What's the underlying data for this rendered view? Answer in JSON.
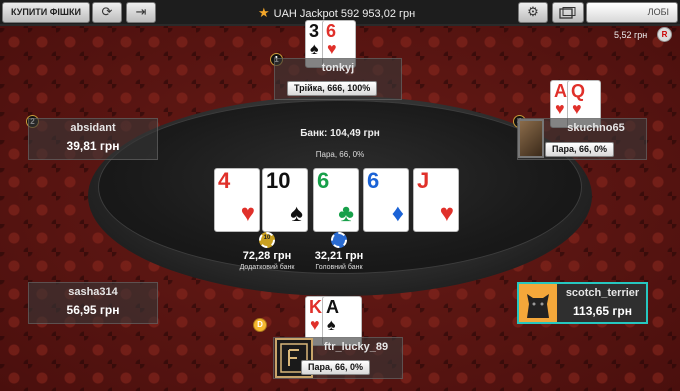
{
  "topbar": {
    "buy_chips_label": "КУПИТИ ФІШКИ",
    "refresh_icon": "refresh-icon",
    "exit_icon": "exit-icon",
    "jackpot_text": "UAH Jackpot  592 953,02 грн",
    "settings_icon": "gear-icon",
    "tables_icon": "tables-icon",
    "lobby_label": "ЛОБІ",
    "timer": "5,52 грн",
    "r_badge": "R"
  },
  "table": {
    "pot_label": "Банк: 104,49 грн",
    "hand_desc": "Пара, 66, 0%",
    "board": [
      {
        "rank": "4",
        "suit": "♥",
        "color": "red"
      },
      {
        "rank": "10",
        "suit": "♠",
        "color": "black"
      },
      {
        "rank": "6",
        "suit": "♣",
        "color": "green"
      },
      {
        "rank": "6",
        "suit": "♦",
        "color": "blue"
      },
      {
        "rank": "J",
        "suit": "♥",
        "color": "red"
      }
    ],
    "side_pot": {
      "amount": "72,28 грн",
      "label": "Додатковий банк",
      "chip_count": "10"
    },
    "main_pot": {
      "amount": "32,21 грн",
      "label": "Головний банк"
    },
    "dealer_label": "D"
  },
  "seats": {
    "tonkyj": {
      "name": "tonkyj",
      "number": "1",
      "hand": "Трійка, 666, 100%",
      "cards": [
        {
          "rank": "3",
          "suit": "♠",
          "color": "black"
        },
        {
          "rank": "6",
          "suit": "♥",
          "color": "red"
        }
      ]
    },
    "absidant": {
      "name": "absidant",
      "number": "2",
      "stack": "39,81 грн"
    },
    "skuchno65": {
      "name": "skuchno65",
      "number": "4",
      "hand": "Пара, 66, 0%",
      "cards": [
        {
          "rank": "A",
          "suit": "♥",
          "color": "red"
        },
        {
          "rank": "Q",
          "suit": "♥",
          "color": "red"
        }
      ]
    },
    "sasha314": {
      "name": "sasha314",
      "stack": "56,95 грн"
    },
    "scotch_terrier": {
      "name": "scotch_terrier",
      "stack": "113,65 грн"
    },
    "ftr_lucky_89": {
      "name": "ftr_lucky_89",
      "hand": "Пара, 66, 0%",
      "cards": [
        {
          "rank": "K",
          "suit": "♥",
          "color": "red"
        },
        {
          "rank": "A",
          "suit": "♠",
          "color": "black"
        }
      ]
    }
  }
}
